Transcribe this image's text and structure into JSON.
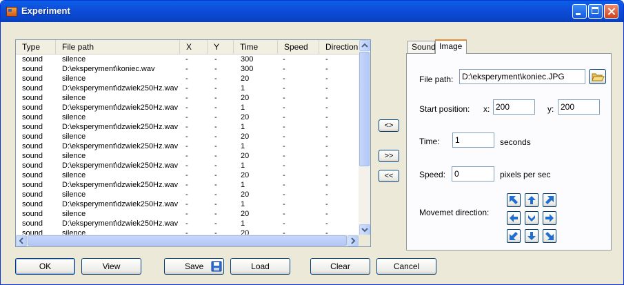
{
  "window": {
    "title": "Experiment"
  },
  "table": {
    "columns": [
      "Type",
      "File path",
      "X",
      "Y",
      "Time",
      "Speed",
      "Direction"
    ],
    "rows": [
      [
        "sound",
        "silence",
        "-",
        "-",
        "300",
        "-",
        "-"
      ],
      [
        "sound",
        "D:\\eksperyment\\koniec.wav",
        "-",
        "-",
        "300",
        "-",
        "-"
      ],
      [
        "sound",
        "silence",
        "-",
        "-",
        "20",
        "-",
        "-"
      ],
      [
        "sound",
        "D:\\eksperyment\\dzwiek250Hz.wav",
        "-",
        "-",
        "1",
        "-",
        "-"
      ],
      [
        "sound",
        "silence",
        "-",
        "-",
        "20",
        "-",
        "-"
      ],
      [
        "sound",
        "D:\\eksperyment\\dzwiek250Hz.wav",
        "-",
        "-",
        "1",
        "-",
        "-"
      ],
      [
        "sound",
        "silence",
        "-",
        "-",
        "20",
        "-",
        "-"
      ],
      [
        "sound",
        "D:\\eksperyment\\dzwiek250Hz.wav",
        "-",
        "-",
        "1",
        "-",
        "-"
      ],
      [
        "sound",
        "silence",
        "-",
        "-",
        "20",
        "-",
        "-"
      ],
      [
        "sound",
        "D:\\eksperyment\\dzwiek250Hz.wav",
        "-",
        "-",
        "1",
        "-",
        "-"
      ],
      [
        "sound",
        "silence",
        "-",
        "-",
        "20",
        "-",
        "-"
      ],
      [
        "sound",
        "D:\\eksperyment\\dzwiek250Hz.wav",
        "-",
        "-",
        "1",
        "-",
        "-"
      ],
      [
        "sound",
        "silence",
        "-",
        "-",
        "20",
        "-",
        "-"
      ],
      [
        "sound",
        "D:\\eksperyment\\dzwiek250Hz.wav",
        "-",
        "-",
        "1",
        "-",
        "-"
      ],
      [
        "sound",
        "silence",
        "-",
        "-",
        "20",
        "-",
        "-"
      ],
      [
        "sound",
        "D:\\eksperyment\\dzwiek250Hz.wav",
        "-",
        "-",
        "1",
        "-",
        "-"
      ],
      [
        "sound",
        "silence",
        "-",
        "-",
        "20",
        "-",
        "-"
      ],
      [
        "sound",
        "D:\\eksperyment\\dzwiek250Hz.wav",
        "-",
        "-",
        "1",
        "-",
        "-"
      ],
      [
        "sound",
        "silence",
        "-",
        "-",
        "20",
        "-",
        "-"
      ]
    ]
  },
  "move_buttons": {
    "swap": "<>",
    "add": ">>",
    "remove": "<<"
  },
  "tabs": [
    {
      "label": "Sound",
      "active": false
    },
    {
      "label": "Image",
      "active": true
    }
  ],
  "image_tab": {
    "file_path_label": "File path:",
    "file_path_value": "D:\\eksperyment\\koniec.JPG",
    "start_position_label": "Start position:",
    "x_label": "x:",
    "x_value": "200",
    "y_label": "y:",
    "y_value": "200",
    "time_label": "Time:",
    "time_value": "1",
    "time_unit": "seconds",
    "speed_label": "Speed:",
    "speed_value": "0",
    "speed_unit": "pixels per sec",
    "direction_label": "Movemet direction:"
  },
  "buttons": {
    "ok": "OK",
    "view": "View",
    "save": "Save",
    "load": "Load",
    "clear": "Clear",
    "cancel": "Cancel"
  },
  "colors": {
    "accent": "#0a5fe6",
    "tab_highlight": "#e68b2c",
    "arrow_blue": "#1f6fd1"
  }
}
